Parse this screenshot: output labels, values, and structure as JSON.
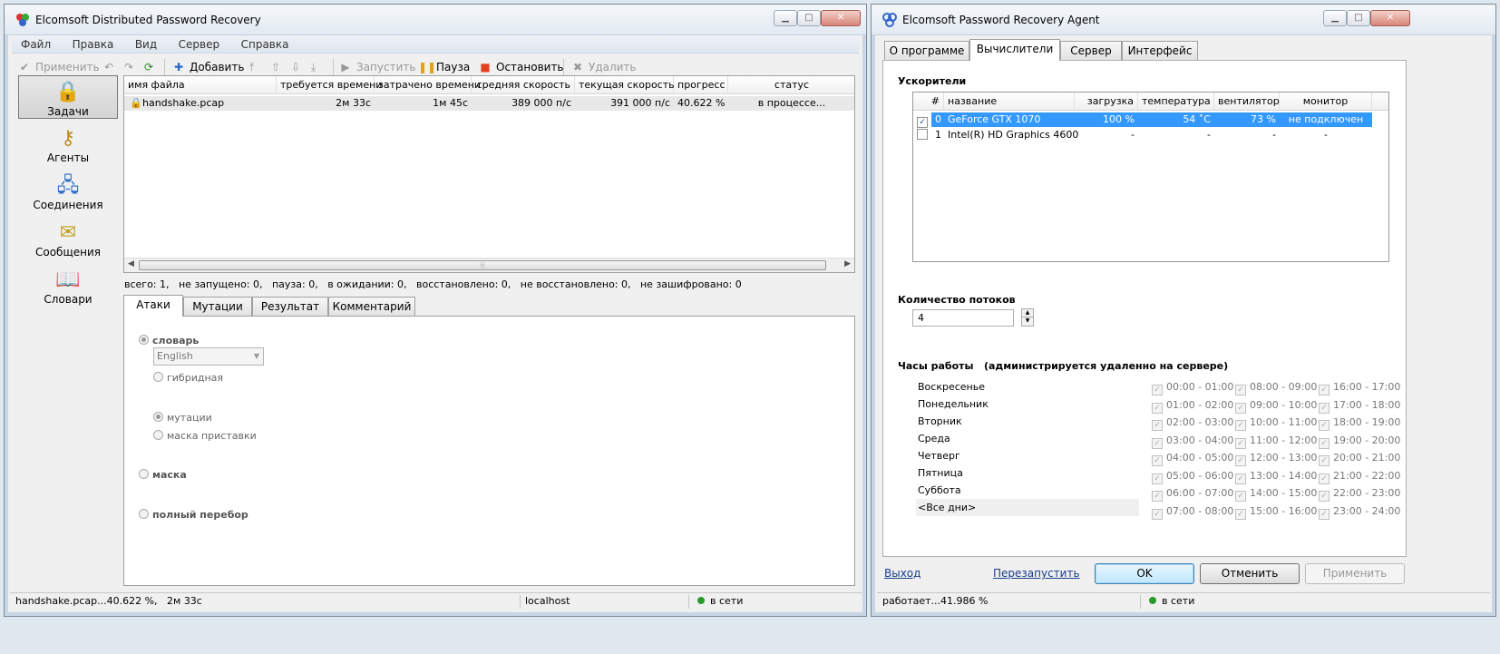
{
  "left": {
    "title": "Elcomsoft Distributed Password Recovery",
    "menu": [
      "Файл",
      "Правка",
      "Вид",
      "Сервер",
      "Справка"
    ],
    "toolbar": {
      "apply": "Применить",
      "add": "Добавить",
      "start": "Запустить",
      "pause": "Пауза",
      "stop": "Остановить",
      "delete": "Удалить"
    },
    "sidebar": [
      "Задачи",
      "Агенты",
      "Соединения",
      "Сообщения",
      "Словари"
    ],
    "columns": [
      "имя файла",
      "требуется времени",
      "затрачено времени",
      "средняя скорость",
      "текущая скорость",
      "прогресс",
      "статус"
    ],
    "row": {
      "file": "handshake.pcap",
      "required": "2м 33с",
      "spent": "1м 45с",
      "avg": "389 000  п/с",
      "cur": "391 000  п/с",
      "progress": "40.622 %",
      "status": "в процессе..."
    },
    "summary": "всего: 1,   не запущено: 0,   пауза: 0,   в ожидании: 0,   восстановлено: 0,   не восстановлено: 0,   не зашифровано: 0",
    "tabs": [
      "Атаки",
      "Мутации",
      "Результат",
      "Комментарий"
    ],
    "attack": {
      "dictionary": "словарь",
      "language": "English",
      "hybrid": "гибридная",
      "mutations": "мутации",
      "prefix_mask": "маска приставки",
      "mask": "маска",
      "brute": "полный перебор"
    },
    "status": {
      "task": "handshake.pcap...40.622 %,   2м 33с",
      "host": "localhost",
      "online": "в сети"
    }
  },
  "right": {
    "title": "Elcomsoft Password Recovery Agent",
    "tabs": [
      "О программе",
      "Вычислители",
      "Сервер",
      "Интерфейс"
    ],
    "accel_title": "Ускорители",
    "accel_columns": [
      "#",
      "название",
      "загрузка",
      "температура",
      "вентилятор",
      "монитор"
    ],
    "accel_rows": [
      {
        "num": "0",
        "name": "GeForce GTX 1070",
        "load": "100 %",
        "temp": "54 ˚C",
        "fan": "73 %",
        "monitor": "не подключен",
        "checked": true
      },
      {
        "num": "1",
        "name": "Intel(R) HD Graphics 4600",
        "load": "-",
        "temp": "-",
        "fan": "-",
        "monitor": "-",
        "checked": false
      }
    ],
    "threads_label": "Количество потоков",
    "threads_value": "4",
    "hours_title": "Часы работы   (администрируется удаленно на сервере)",
    "days": [
      "Воскресенье",
      "Понедельник",
      "Вторник",
      "Среда",
      "Четверг",
      "Пятница",
      "Суббота",
      "<Все дни>"
    ],
    "hours_col1": [
      "00:00 - 01:00",
      "01:00 - 02:00",
      "02:00 - 03:00",
      "03:00 - 04:00",
      "04:00 - 05:00",
      "05:00 - 06:00",
      "06:00 - 07:00",
      "07:00 - 08:00"
    ],
    "hours_col2": [
      "08:00 - 09:00",
      "09:00 - 10:00",
      "10:00 - 11:00",
      "11:00 - 12:00",
      "12:00 - 13:00",
      "13:00 - 14:00",
      "14:00 - 15:00",
      "15:00 - 16:00"
    ],
    "hours_col3": [
      "16:00 - 17:00",
      "17:00 - 18:00",
      "18:00 - 19:00",
      "19:00 - 20:00",
      "20:00 - 21:00",
      "21:00 - 22:00",
      "22:00 - 23:00",
      "23:00 - 24:00"
    ],
    "exit": "Выход",
    "restart": "Перезапустить",
    "ok": "OK",
    "cancel": "Отменить",
    "apply": "Применить",
    "status": {
      "work": "работает...41.986 %",
      "online": "в сети"
    }
  }
}
